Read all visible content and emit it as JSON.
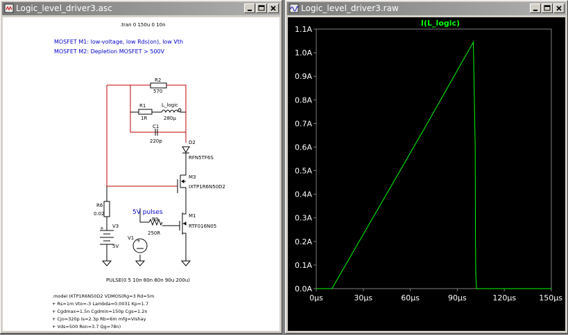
{
  "windows": {
    "schematic": {
      "title": "Logic_level_driver3.asc"
    },
    "plot": {
      "title": "Logic_level_driver3.raw"
    }
  },
  "schematic": {
    "directive_tran": ".tran 0 150u 0 10n",
    "comment_line1": "MOSFET M1: low-voltage, low Rds(on), low Vth",
    "comment_line2": "MOSFET M2: Depletion MOSFET > 500V",
    "pulses_label": "5V pulses",
    "components": {
      "r2": {
        "name": "R2",
        "value": "570"
      },
      "r1": {
        "name": "R1",
        "value": "1R"
      },
      "l_logic": {
        "name": "L_logic",
        "value": "280µ"
      },
      "c1": {
        "name": "C1",
        "value": "220p"
      },
      "d2": {
        "name": "D2",
        "value": "RFN5TF6S"
      },
      "m3": {
        "name": "M3",
        "value": "IXTP1R6N50D2"
      },
      "r6": {
        "name": "R6",
        "value": "0.02"
      },
      "v3": {
        "name": "V3",
        "value": "5V"
      },
      "r9": {
        "name": "R9",
        "value": "250R"
      },
      "m1": {
        "name": "M1",
        "value": "RTF016N05"
      },
      "v1": {
        "name": "V1",
        "value": "PULSE(0 5 10n 80n 80n 90u 200u)"
      }
    },
    "model_lines": [
      ".model IXTP1R6N50D2 VDMOS(Rg=3 Rd=5m",
      "+ Rs=1m Vto=-3 Lambda=0.0031 Kp=1.7",
      "+ Cgdmax=1.5n Cgdmin=150p Cgs=1.2n",
      "+ Cjo=320p Is=2.3p Rb=6m mfg=Vishay",
      "+ Vds=500 Ron=3.7 Qg=78n)"
    ]
  },
  "plot": {
    "trace_label": "I(L_logic)",
    "colors": {
      "background": "#000000",
      "trace": "#00ff00",
      "grid": "#808080",
      "axis_text": "#ffffff"
    }
  },
  "chart_data": {
    "type": "line",
    "title": "I(L_logic)",
    "xlabel": "",
    "ylabel": "",
    "x_unit": "µs",
    "xlim": [
      0,
      150
    ],
    "ylim": [
      0.0,
      1.1
    ],
    "x_ticks": [
      "0µs",
      "30µs",
      "60µs",
      "90µs",
      "120µs",
      "150µs"
    ],
    "y_ticks": [
      "0.0A",
      "0.1A",
      "0.2A",
      "0.3A",
      "0.4A",
      "0.5A",
      "0.6A",
      "0.7A",
      "0.8A",
      "0.9A",
      "1.0A",
      "1.1A"
    ],
    "grid": false,
    "series": [
      {
        "name": "I(L_logic)",
        "color": "#00ff00",
        "x": [
          0,
          10,
          30,
          50,
          70,
          90,
          100.2,
          101.4,
          101.6,
          101.8,
          102.3,
          150
        ],
        "y": [
          0.0,
          0.0,
          0.23,
          0.46,
          0.69,
          0.925,
          1.045,
          0.6,
          0.2,
          0.05,
          0.0,
          0.0
        ]
      }
    ]
  }
}
